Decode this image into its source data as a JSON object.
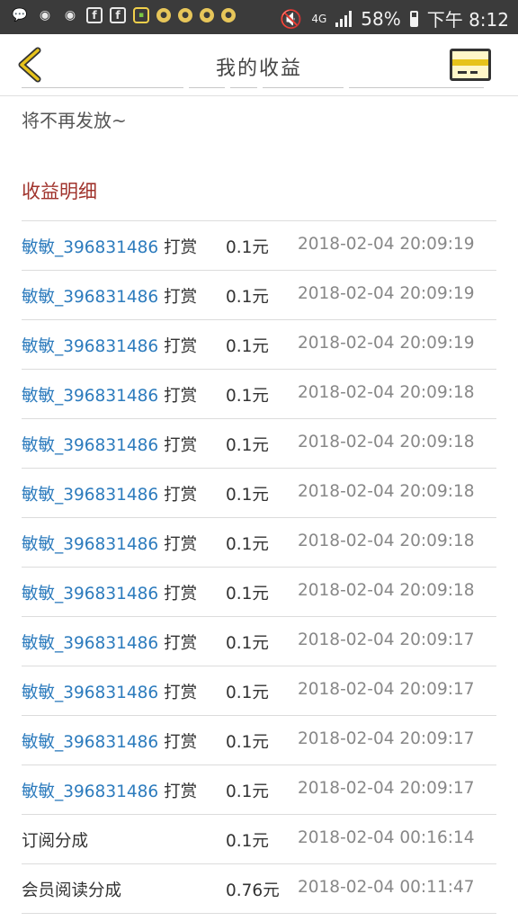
{
  "status_bar": {
    "left_icons": [
      "message-icon",
      "weibo-icon",
      "weibo-icon",
      "facebook-icon",
      "facebook-icon",
      "app-icon",
      "notification-icon",
      "notification-icon",
      "notification-icon",
      "notification-icon"
    ],
    "network": "4G",
    "battery": "58%",
    "time": "下午 8:12"
  },
  "header": {
    "title": "我的收益",
    "accent_color": "#e7c31b"
  },
  "notice_text": "将不再发放~",
  "section_title": "收益明细",
  "rows": [
    {
      "user": "敏敏_396831486",
      "action": "打赏",
      "amount": "0.1元",
      "time": "2018-02-04 20:09:19"
    },
    {
      "user": "敏敏_396831486",
      "action": "打赏",
      "amount": "0.1元",
      "time": "2018-02-04 20:09:19"
    },
    {
      "user": "敏敏_396831486",
      "action": "打赏",
      "amount": "0.1元",
      "time": "2018-02-04 20:09:19"
    },
    {
      "user": "敏敏_396831486",
      "action": "打赏",
      "amount": "0.1元",
      "time": "2018-02-04 20:09:18"
    },
    {
      "user": "敏敏_396831486",
      "action": "打赏",
      "amount": "0.1元",
      "time": "2018-02-04 20:09:18"
    },
    {
      "user": "敏敏_396831486",
      "action": "打赏",
      "amount": "0.1元",
      "time": "2018-02-04 20:09:18"
    },
    {
      "user": "敏敏_396831486",
      "action": "打赏",
      "amount": "0.1元",
      "time": "2018-02-04 20:09:18"
    },
    {
      "user": "敏敏_396831486",
      "action": "打赏",
      "amount": "0.1元",
      "time": "2018-02-04 20:09:18"
    },
    {
      "user": "敏敏_396831486",
      "action": "打赏",
      "amount": "0.1元",
      "time": "2018-02-04 20:09:17"
    },
    {
      "user": "敏敏_396831486",
      "action": "打赏",
      "amount": "0.1元",
      "time": "2018-02-04 20:09:17"
    },
    {
      "user": "敏敏_396831486",
      "action": "打赏",
      "amount": "0.1元",
      "time": "2018-02-04 20:09:17"
    },
    {
      "user": "敏敏_396831486",
      "action": "打赏",
      "amount": "0.1元",
      "time": "2018-02-04 20:09:17"
    },
    {
      "user": "",
      "action": "订阅分成",
      "amount": "0.1元",
      "time": "2018-02-04 00:16:14"
    },
    {
      "user": "",
      "action": "会员阅读分成",
      "amount": "0.76元",
      "time": "2018-02-04 00:11:47"
    }
  ]
}
